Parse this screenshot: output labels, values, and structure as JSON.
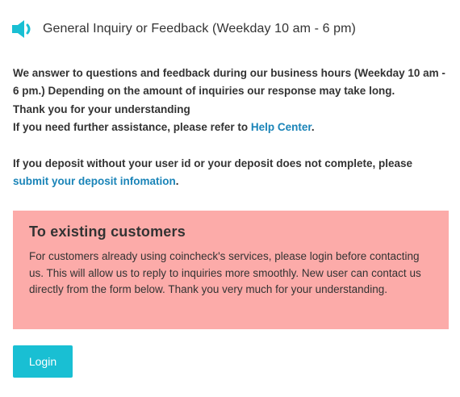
{
  "header": {
    "icon": "speaker-icon",
    "title": "General Inquiry or Feedback (Weekday 10 am - 6 pm)"
  },
  "intro": {
    "para1_line1": "We answer to questions and feedback during our business hours (Weekday 10 am - 6 pm.) Depending on the amount of inquiries our response may take long.",
    "para1_line2": "Thank you for your understanding",
    "para1_line3_prefix": "If you need further assistance, please refer to ",
    "help_center_link": "Help Center",
    "para1_line3_suffix": ".",
    "para2_prefix": "If you deposit without your user id or your deposit does not complete, please ",
    "deposit_link": "submit your deposit infomation",
    "para2_suffix": "."
  },
  "notice": {
    "title": "To existing customers",
    "body": "For customers already using coincheck's services, please login before contacting us. This will allow us to reply to inquiries more smoothly. New user can contact us directly from the form below. Thank you very much for your understanding."
  },
  "login_button": {
    "label": "Login"
  },
  "colors": {
    "accent": "#19bfd3",
    "link": "#1a84b8",
    "notice_bg": "#fcaba9",
    "text": "#333333"
  }
}
